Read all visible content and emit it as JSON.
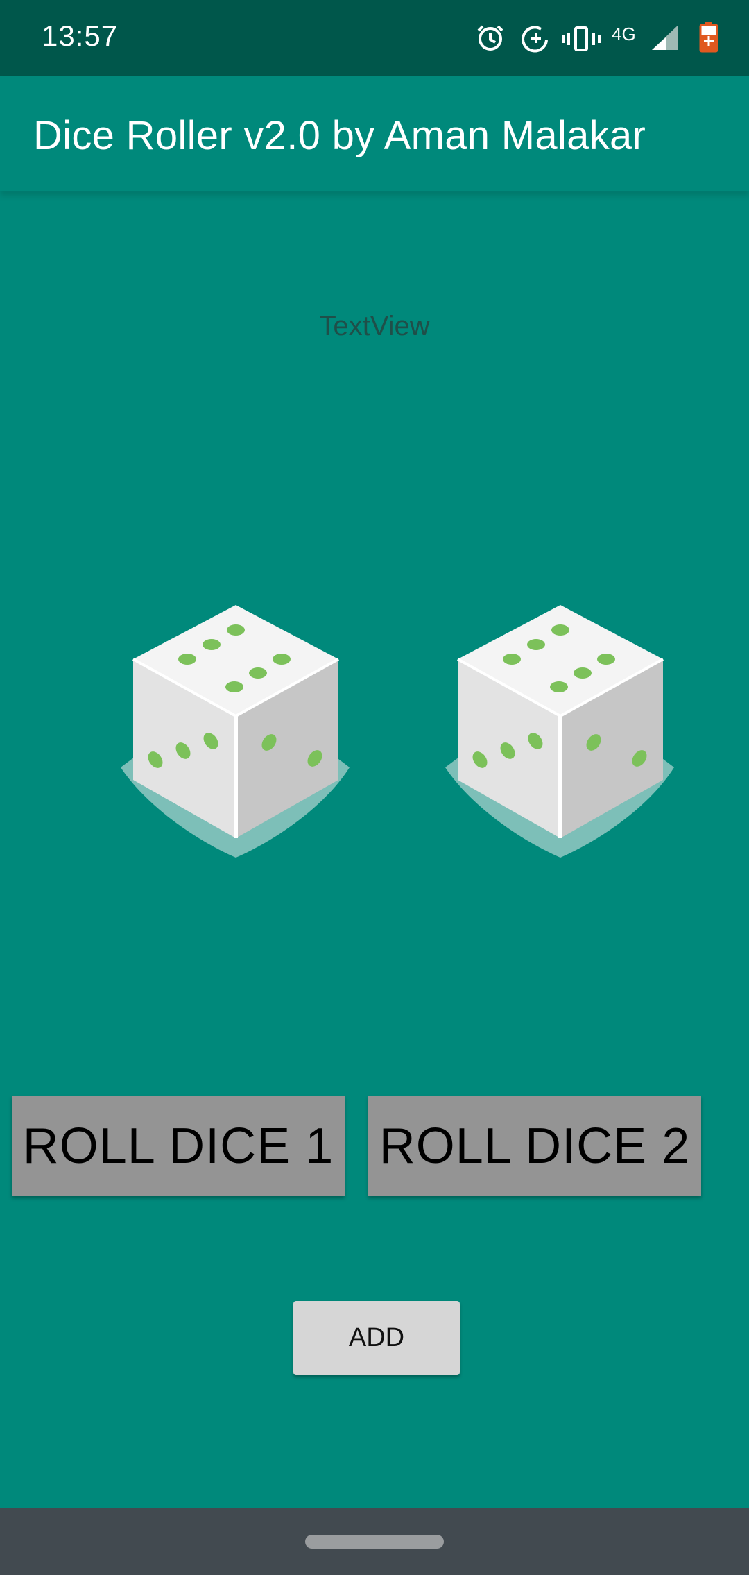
{
  "status_bar": {
    "time": "13:57",
    "network": "4G",
    "icons": [
      "alarm-icon",
      "data-saver-icon",
      "vibrate-icon",
      "signal-icon",
      "battery-icon"
    ]
  },
  "app_bar": {
    "title": "Dice Roller v2.0 by Aman Malakar"
  },
  "main": {
    "result_text": "TextView",
    "dice": [
      {
        "label": "dice-1",
        "face": "three-dimensional die showing multiple pips"
      },
      {
        "label": "dice-2",
        "face": "three-dimensional die showing multiple pips"
      }
    ],
    "roll_dice_1_label": "ROLL DICE 1",
    "roll_dice_2_label": "ROLL DICE 2",
    "add_label": "ADD"
  },
  "colors": {
    "background": "#00897B",
    "status_bar": "#00574B",
    "button_gray": "#949494",
    "add_button": "#D6D6D6",
    "pip_green": "#7CC15A",
    "nav_bar": "#424A50"
  }
}
